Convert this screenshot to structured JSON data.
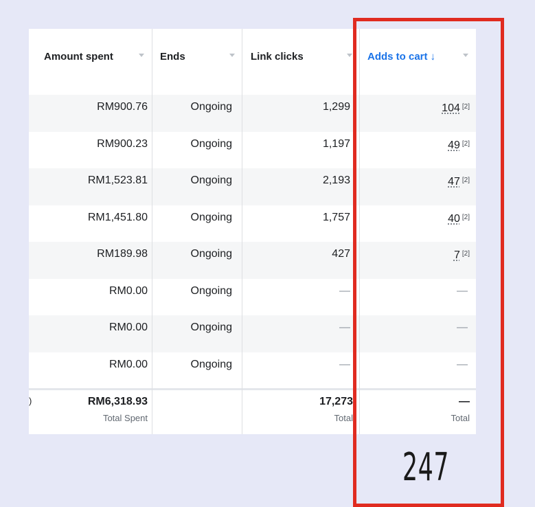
{
  "table": {
    "columns": [
      {
        "label": "Amount spent",
        "sort_indicator": ""
      },
      {
        "label": "Ends",
        "sort_indicator": ""
      },
      {
        "label": "Link clicks",
        "sort_indicator": ""
      },
      {
        "label": "Adds to cart",
        "sort_indicator": "↓"
      }
    ],
    "active_sort_color": "#1a73e8",
    "rows": [
      {
        "amount": "RM900.76",
        "ends": "Ongoing",
        "clicks": "1,299",
        "adds": "104",
        "note": "[2]"
      },
      {
        "amount": "RM900.23",
        "ends": "Ongoing",
        "clicks": "1,197",
        "adds": "49",
        "note": "[2]"
      },
      {
        "amount": "RM1,523.81",
        "ends": "Ongoing",
        "clicks": "2,193",
        "adds": "47",
        "note": "[2]"
      },
      {
        "amount": "RM1,451.80",
        "ends": "Ongoing",
        "clicks": "1,757",
        "adds": "40",
        "note": "[2]"
      },
      {
        "amount": "RM189.98",
        "ends": "Ongoing",
        "clicks": "427",
        "adds": "7",
        "note": "[2]"
      },
      {
        "amount": "RM0.00",
        "ends": "Ongoing",
        "clicks": "—",
        "adds": "—",
        "note": ""
      },
      {
        "amount": "RM0.00",
        "ends": "Ongoing",
        "clicks": "—",
        "adds": "—",
        "note": ""
      },
      {
        "amount": "RM0.00",
        "ends": "Ongoing",
        "clicks": "—",
        "adds": "—",
        "note": ""
      }
    ],
    "totals": {
      "amount_value": "RM6,318.93",
      "amount_label": "Total Spent",
      "clicks_value": "17,273",
      "clicks_label": "Total",
      "adds_value": "—",
      "adds_label": "Total"
    }
  },
  "annotation": {
    "highlight_color": "#e02b20",
    "total_adds_text": "247"
  }
}
